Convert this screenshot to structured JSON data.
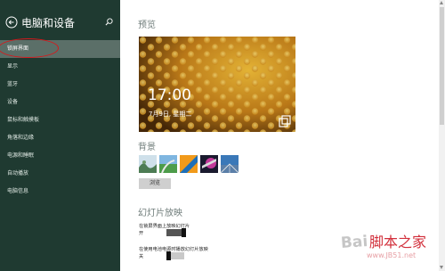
{
  "sidebar": {
    "title": "电脑和设备",
    "items": [
      {
        "label": "锁屏界面",
        "active": true
      },
      {
        "label": "显示"
      },
      {
        "label": "蓝牙"
      },
      {
        "label": "设备"
      },
      {
        "label": "鼠标和触摸板"
      },
      {
        "label": "角落和边缘"
      },
      {
        "label": "电源和睡眠"
      },
      {
        "label": "自动播放"
      },
      {
        "label": "电脑信息"
      }
    ]
  },
  "main": {
    "preview_title": "预览",
    "preview_time": "17:00",
    "preview_date": "7月9日, 星期二",
    "background_title": "背景",
    "browse_label": "浏览",
    "slideshow_title": "幻灯片放映",
    "slideshow_setting_label": "在锁屏界面上放映幻灯片",
    "slideshow_setting_state": "开",
    "battery_setting_label": "在使用电池电源时播放幻灯片放映",
    "battery_setting_state": "关"
  },
  "watermark": {
    "text": "Bai 脚本之家",
    "url": "www.JB51.net"
  },
  "colors": {
    "sidebar_bg": "#1f3a31",
    "sidebar_active": "#5b6f68",
    "annotation_red": "#d7191c"
  }
}
